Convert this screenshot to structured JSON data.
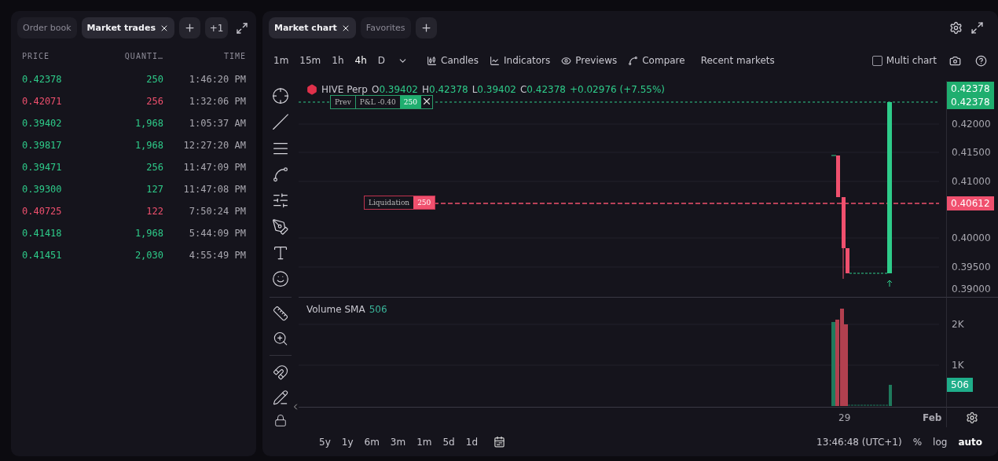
{
  "left_panel": {
    "tabs": [
      {
        "label": "Order book",
        "selected": false,
        "closable": false
      },
      {
        "label": "Market trades",
        "selected": true,
        "closable": true
      }
    ],
    "more_count": "+1",
    "columns": [
      "PRICE",
      "QUANTI…",
      "TIME"
    ],
    "rows": [
      {
        "price": "0.42378",
        "quantity": "250",
        "time": "1:46:20 PM",
        "color": "#2ecc8a"
      },
      {
        "price": "0.42071",
        "quantity": "256",
        "time": "1:32:06 PM",
        "color": "#f0506e"
      },
      {
        "price": "0.39402",
        "quantity": "1,968",
        "time": "1:05:37 AM",
        "color": "#2ecc8a"
      },
      {
        "price": "0.39817",
        "quantity": "1,968",
        "time": "12:27:20 AM",
        "color": "#2ecc8a"
      },
      {
        "price": "0.39471",
        "quantity": "256",
        "time": "11:47:09 PM",
        "color": "#2ecc8a"
      },
      {
        "price": "0.39300",
        "quantity": "127",
        "time": "11:47:08 PM",
        "color": "#2ecc8a"
      },
      {
        "price": "0.40725",
        "quantity": "122",
        "time": "7:50:24 PM",
        "color": "#f0506e"
      },
      {
        "price": "0.41418",
        "quantity": "1,968",
        "time": "5:44:09 PM",
        "color": "#2ecc8a"
      },
      {
        "price": "0.41451",
        "quantity": "2,030",
        "time": "4:55:49 PM",
        "color": "#2ecc8a"
      }
    ]
  },
  "chart_panel": {
    "tabs": [
      {
        "label": "Market chart",
        "selected": true,
        "closable": true
      },
      {
        "label": "Favorites",
        "selected": false,
        "closable": false
      }
    ],
    "intervals": [
      {
        "label": "1m",
        "selected": false
      },
      {
        "label": "15m",
        "selected": false
      },
      {
        "label": "1h",
        "selected": false
      },
      {
        "label": "4h",
        "selected": true
      },
      {
        "label": "D",
        "selected": false
      }
    ],
    "toolbar": [
      {
        "kind": "candles",
        "label": "Candles"
      },
      {
        "kind": "indicators",
        "label": "Indicators"
      },
      {
        "kind": "previews",
        "label": "Previews"
      },
      {
        "kind": "compare",
        "label": "Compare"
      },
      {
        "kind": "plain",
        "label": "Recent markets"
      }
    ],
    "multi_chart": {
      "label": "Multi chart",
      "checked": false
    },
    "legend": {
      "symbol": "HIVE Perp",
      "ohlc": [
        {
          "key": "O",
          "value": "0.39402"
        },
        {
          "key": "H",
          "value": "0.42378"
        },
        {
          "key": "L",
          "value": "0.39402"
        },
        {
          "key": "C",
          "value": "0.42378"
        }
      ],
      "change": "+0.02976 (+7.55%)"
    },
    "position_label": {
      "title": "Prev",
      "pnl": "P&L -0.40",
      "size": "250"
    },
    "liquidation_label": {
      "title": "Liquidation",
      "size": "250"
    },
    "price_ticks": [
      "0.42000",
      "0.41500",
      "0.41000",
      "0.40000",
      "0.39500",
      "0.39000"
    ],
    "price_badges": [
      {
        "text": "0.42378",
        "kind": "last"
      },
      {
        "text": "0.42378",
        "kind": "last"
      },
      {
        "text": "0.40612",
        "kind": "liquidation"
      }
    ],
    "volume": {
      "label": "Volume SMA",
      "value": "506",
      "ticks": [
        "2K",
        "1K"
      ],
      "badge": "506"
    },
    "time_ticks": [
      "29",
      "Feb"
    ],
    "ranges": [
      "5y",
      "1y",
      "6m",
      "3m",
      "1m",
      "5d",
      "1d"
    ],
    "clock": "13:46:48 (UTC+1)",
    "scale_options": [
      {
        "label": "%",
        "selected": false
      },
      {
        "label": "log",
        "selected": false
      },
      {
        "label": "auto",
        "selected": true
      }
    ]
  }
}
